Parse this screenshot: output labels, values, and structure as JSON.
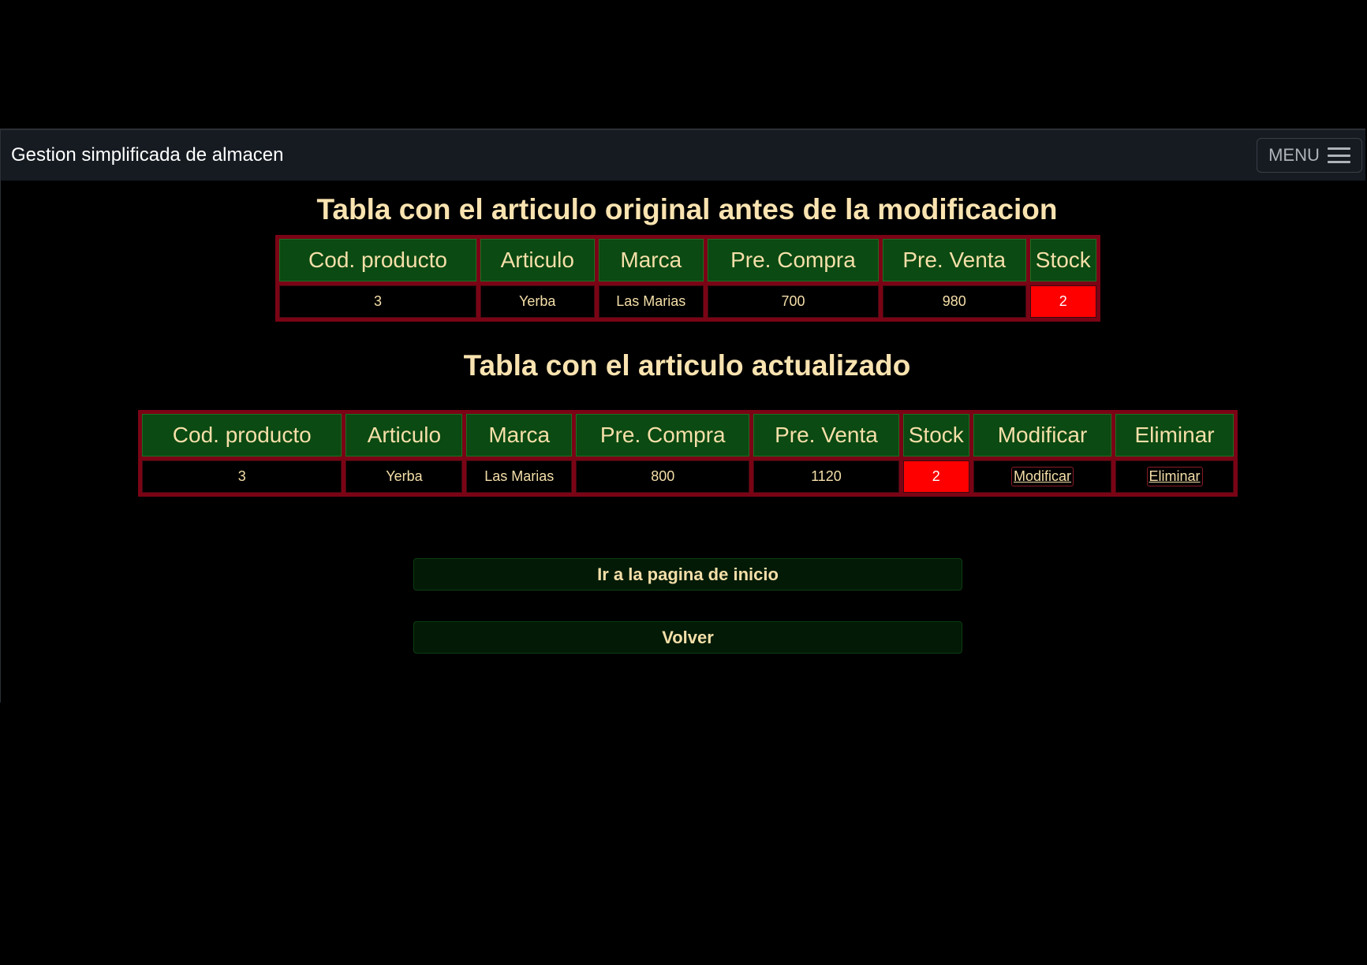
{
  "navbar": {
    "brand": "Gestion simplificada de almacen",
    "menu_label": "MENU"
  },
  "original_section": {
    "title": "Tabla con el articulo original antes de la modificacion",
    "headers": [
      "Cod. producto",
      "Articulo",
      "Marca",
      "Pre. Compra",
      "Pre. Venta",
      "Stock"
    ],
    "row": {
      "codigo": "3",
      "articulo": "Yerba",
      "marca": "Las Marias",
      "pre_compra": "700",
      "pre_venta": "980",
      "stock": "2"
    }
  },
  "updated_section": {
    "title": "Tabla con el articulo actualizado",
    "headers": [
      "Cod. producto",
      "Articulo",
      "Marca",
      "Pre. Compra",
      "Pre. Venta",
      "Stock",
      "Modificar",
      "Eliminar"
    ],
    "row": {
      "codigo": "3",
      "articulo": "Yerba",
      "marca": "Las Marias",
      "pre_compra": "800",
      "pre_venta": "1120",
      "stock": "2",
      "modificar_link": "Modificar",
      "eliminar_link": "Eliminar"
    }
  },
  "buttons": {
    "home": "Ir a la pagina de inicio",
    "back": "Volver"
  },
  "colors": {
    "table_border": "#7a0415",
    "header_bg": "#0b4a12",
    "stock_alert": "#ff0000",
    "text": "#f5dfa9"
  }
}
